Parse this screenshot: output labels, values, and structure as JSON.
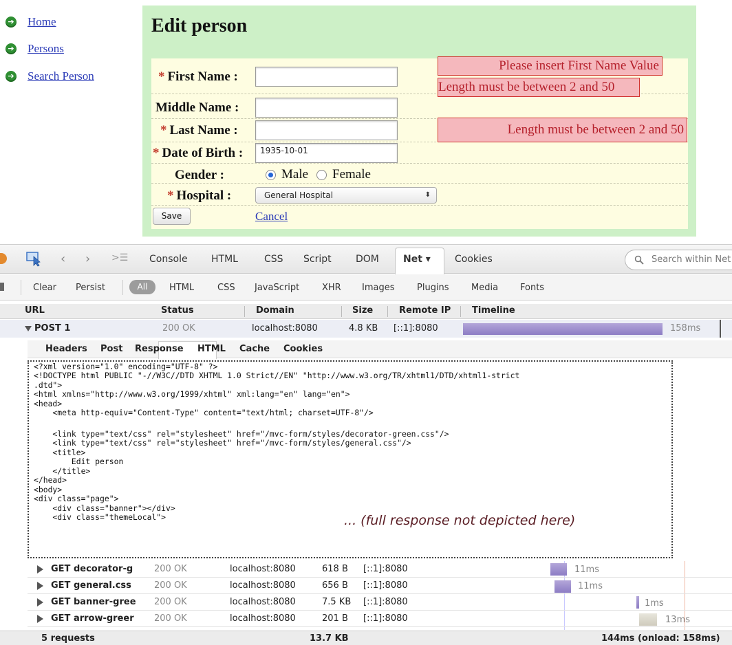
{
  "nav": {
    "items": [
      {
        "label": "Home"
      },
      {
        "label": "Persons"
      },
      {
        "label": "Search Person"
      }
    ]
  },
  "form": {
    "title": "Edit person",
    "first_name_label": "First Name :",
    "middle_name_label": "Middle Name :",
    "last_name_label": "Last Name :",
    "dob_label": "Date of Birth :",
    "gender_label": "Gender :",
    "hospital_label": "Hospital :",
    "required_mark": "*",
    "first_name_value": "",
    "middle_name_value": "",
    "last_name_value": "",
    "dob_value": "1935-10-01",
    "gender_male": "Male",
    "gender_female": "Female",
    "gender_selected": "Male",
    "hospital_value": "General Hospital",
    "save_label": "Save",
    "cancel_label": "Cancel",
    "errors": {
      "first_name_required": "Please insert First Name Value",
      "first_name_length": "Length must be between 2 and 50",
      "last_name_length": "Length must be between 2 and 50"
    }
  },
  "devtools": {
    "main_tabs": [
      "Console",
      "HTML",
      "CSS",
      "Script",
      "DOM",
      "Net ▾",
      "Cookies"
    ],
    "active_tab": "Net",
    "search_placeholder": "Search within Net panel",
    "filters": [
      "Clear",
      "Persist",
      "All",
      "HTML",
      "CSS",
      "JavaScript",
      "XHR",
      "Images",
      "Plugins",
      "Media",
      "Fonts"
    ],
    "active_filter": "All",
    "columns": [
      "URL",
      "Status",
      "Domain",
      "Size",
      "Remote IP",
      "Timeline"
    ],
    "post_request": {
      "url": "POST 1",
      "status": "200 OK",
      "domain": "localhost:8080",
      "size": "4.8 KB",
      "remote_ip": "[::1]:8080",
      "time": "158ms"
    },
    "sub_tabs": [
      "Headers",
      "Post",
      "Response",
      "HTML",
      "Cache",
      "Cookies"
    ],
    "active_sub_tab": "Response",
    "response_lines": [
      "<?xml version=\"1.0\" encoding=\"UTF-8\" ?>",
      "<!DOCTYPE html PUBLIC \"-//W3C//DTD XHTML 1.0 Strict//EN\" \"http://www.w3.org/TR/xhtml1/DTD/xhtml1-strict",
      ".dtd\">",
      "<html xmlns=\"http://www.w3.org/1999/xhtml\" xml:lang=\"en\" lang=\"en\">",
      "<head>",
      "    <meta http-equiv=\"Content-Type\" content=\"text/html; charset=UTF-8\"/>",
      "",
      "    <link type=\"text/css\" rel=\"stylesheet\" href=\"/mvc-form/styles/decorator-green.css\"/>",
      "    <link type=\"text/css\" rel=\"stylesheet\" href=\"/mvc-form/styles/general.css\"/>",
      "    <title>",
      "        Edit person",
      "    </title>",
      "</head>",
      "<body>",
      "<div class=\"page\">",
      "    <div class=\"banner\"></div>",
      "    <div class=\"themeLocal\">"
    ],
    "response_note": "... (full response not depicted here)",
    "get_requests": [
      {
        "url": "GET decorator-g",
        "status": "200 OK",
        "domain": "localhost:8080",
        "size": "618 B",
        "remote_ip": "[::1]:8080",
        "time": "11ms"
      },
      {
        "url": "GET general.css",
        "status": "200 OK",
        "domain": "localhost:8080",
        "size": "656 B",
        "remote_ip": "[::1]:8080",
        "time": "11ms"
      },
      {
        "url": "GET banner-gree",
        "status": "200 OK",
        "domain": "localhost:8080",
        "size": "7.5 KB",
        "remote_ip": "[::1]:8080",
        "time": "1ms"
      },
      {
        "url": "GET arrow-greer",
        "status": "200 OK",
        "domain": "localhost:8080",
        "size": "201 B",
        "remote_ip": "[::1]:8080",
        "time": "13ms"
      }
    ],
    "footer": {
      "requests": "5 requests",
      "total_size": "13.7 KB",
      "total_time": "144ms (onload: 158ms)"
    }
  }
}
